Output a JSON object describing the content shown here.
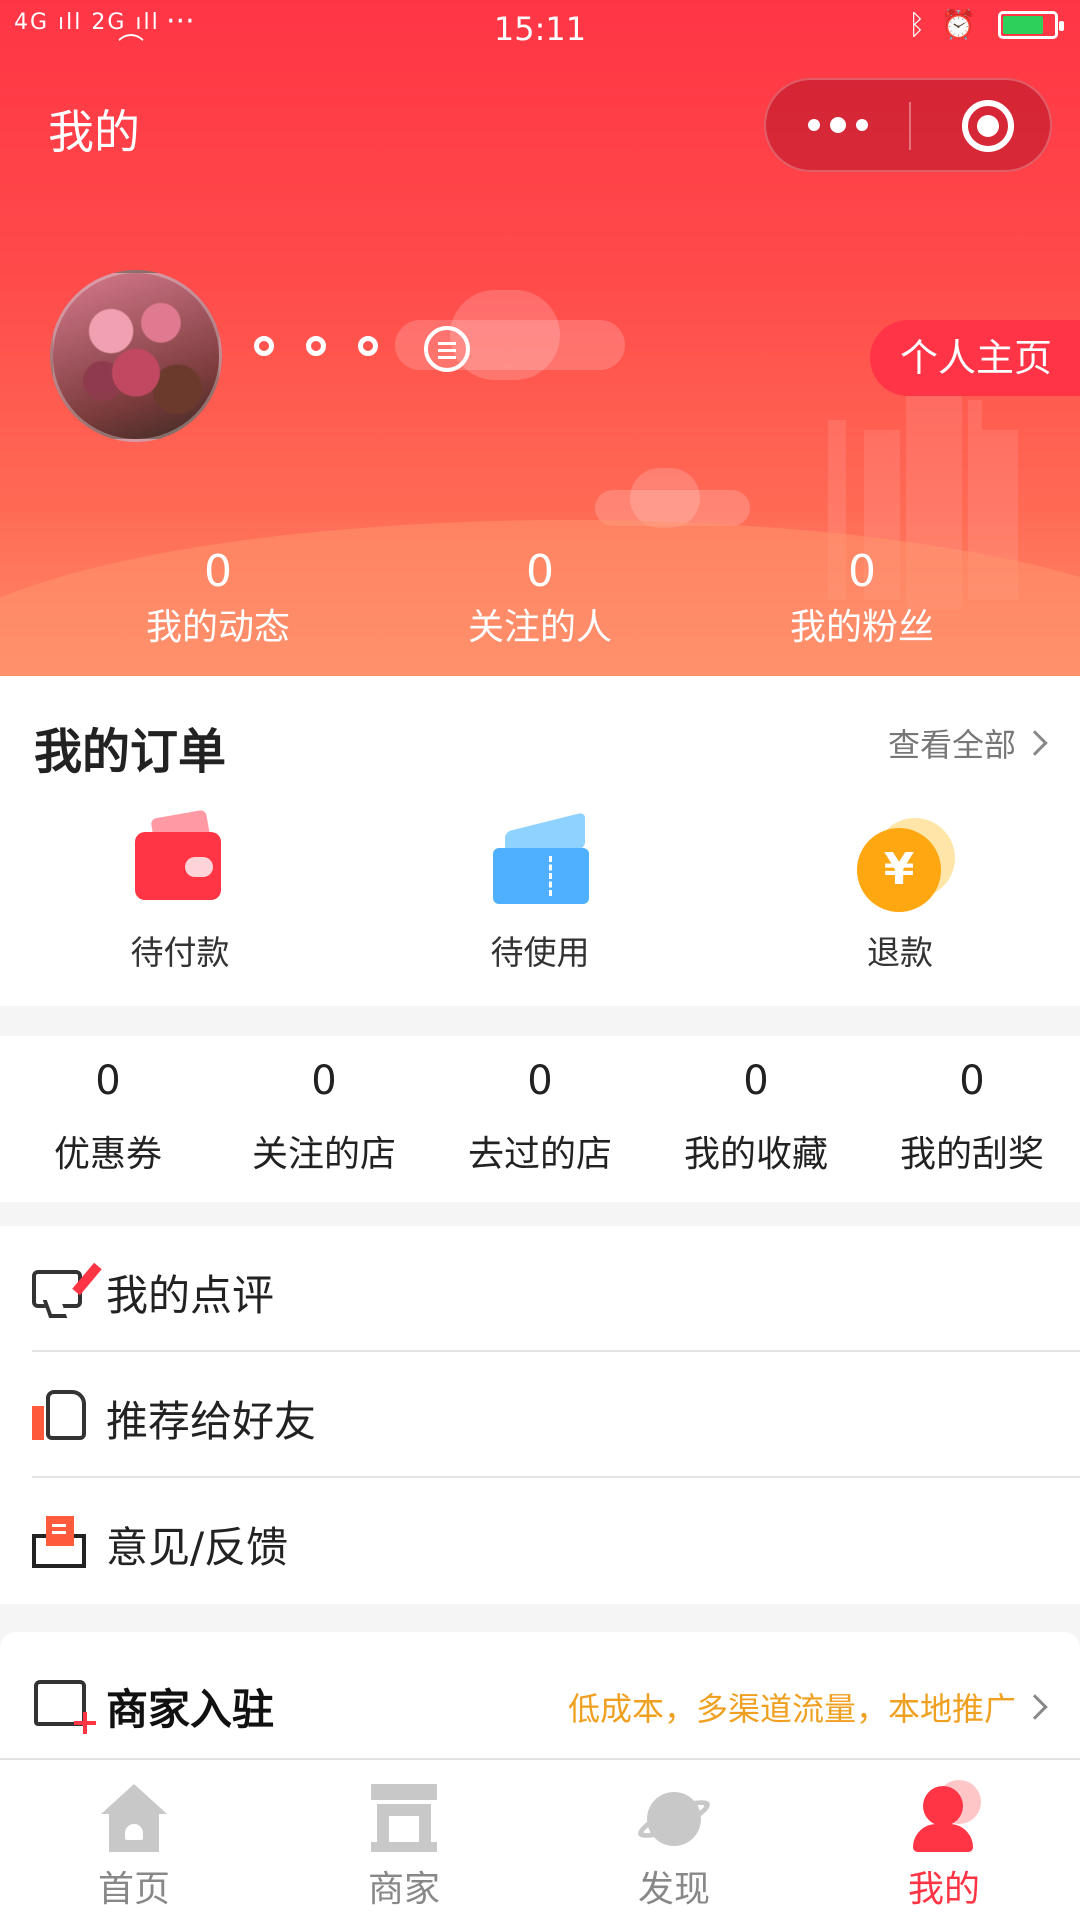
{
  "status_bar": {
    "signal_left": "4G ıll 2G ıll",
    "time": "15:11",
    "icons": [
      "wifi-icon",
      "more-dots-icon",
      "bluetooth-icon",
      "alarm-icon",
      "battery-icon"
    ],
    "battery_level": 0.8
  },
  "header": {
    "title": "我的",
    "profile_button": "个人主页",
    "nickname_dots": 3,
    "stats": [
      {
        "value": "0",
        "label": "我的动态"
      },
      {
        "value": "0",
        "label": "关注的人"
      },
      {
        "value": "0",
        "label": "我的粉丝"
      }
    ],
    "colors": {
      "primary": "#ff3545",
      "bottom": "#ff8c6a"
    }
  },
  "orders": {
    "title": "我的订单",
    "view_all": "查看全部",
    "items": [
      {
        "label": "待付款",
        "icon": "wallet-icon"
      },
      {
        "label": "待使用",
        "icon": "ticket-icon"
      },
      {
        "label": "退款",
        "icon": "refund-coin-icon",
        "symbol": "¥"
      }
    ]
  },
  "counters": [
    {
      "value": "0",
      "label": "优惠券"
    },
    {
      "value": "0",
      "label": "关注的店"
    },
    {
      "value": "0",
      "label": "去过的店"
    },
    {
      "value": "0",
      "label": "我的收藏"
    },
    {
      "value": "0",
      "label": "我的刮奖"
    }
  ],
  "menu": [
    {
      "label": "我的点评",
      "icon": "comment-edit-icon"
    },
    {
      "label": "推荐给好友",
      "icon": "thumbs-up-icon"
    },
    {
      "label": "意见/反馈",
      "icon": "feedback-mail-icon"
    }
  ],
  "merchant": {
    "title": "商家入驻",
    "promo": "低成本，多渠道流量，本地推广",
    "accent": "#f0a020"
  },
  "tabbar": [
    {
      "label": "首页",
      "icon": "home-icon",
      "active": false
    },
    {
      "label": "商家",
      "icon": "shop-icon",
      "active": false
    },
    {
      "label": "发现",
      "icon": "planet-icon",
      "active": false
    },
    {
      "label": "我的",
      "icon": "user-icon",
      "active": true
    }
  ]
}
